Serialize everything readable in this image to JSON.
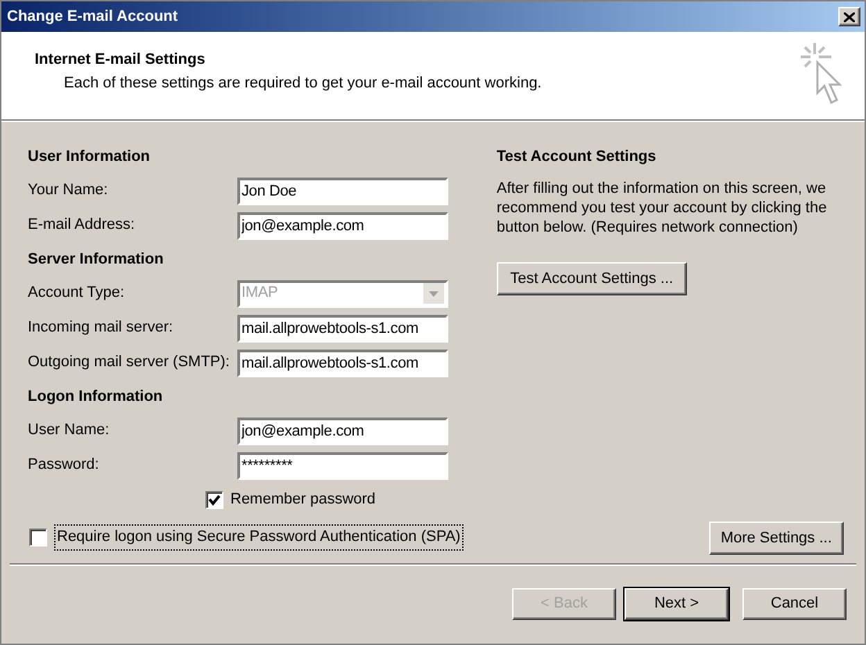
{
  "window": {
    "title": "Change E-mail Account"
  },
  "header": {
    "title": "Internet E-mail Settings",
    "subtitle": "Each of these settings are required to get your e-mail account working."
  },
  "sections": [
    {
      "heading": "User Information",
      "fields": [
        {
          "kind": "text",
          "label": "Your Name:",
          "value": "Jon Doe"
        },
        {
          "kind": "text",
          "label": "E-mail Address:",
          "value": "jon@example.com"
        }
      ]
    },
    {
      "heading": "Server Information",
      "fields": [
        {
          "kind": "select",
          "label": "Account Type:",
          "value": "IMAP",
          "disabled": true
        },
        {
          "kind": "text",
          "label": "Incoming mail server:",
          "value": "mail.allprowebtools-s1.com"
        },
        {
          "kind": "text",
          "label": "Outgoing mail server (SMTP):",
          "value": "mail.allprowebtools-s1.com"
        }
      ]
    },
    {
      "heading": "Logon Information",
      "fields": [
        {
          "kind": "text",
          "label": "User Name:",
          "value": "jon@example.com"
        },
        {
          "kind": "password",
          "label": "Password:",
          "value": "*********"
        }
      ]
    }
  ],
  "remember_password": {
    "label": "Remember password",
    "checked": true
  },
  "spa": {
    "label": "Require logon using Secure Password Authentication (SPA)",
    "checked": false
  },
  "test": {
    "heading": "Test Account Settings",
    "text": "After filling out the information on this screen, we recommend you test your account by clicking the button below. (Requires network connection)",
    "button": "Test Account Settings ..."
  },
  "more_settings": "More Settings ...",
  "buttons": [
    {
      "label": "< Back",
      "disabled": true,
      "default": false
    },
    {
      "label": "Next >",
      "disabled": false,
      "default": true
    },
    {
      "label": "Cancel",
      "disabled": false,
      "default": false
    }
  ]
}
